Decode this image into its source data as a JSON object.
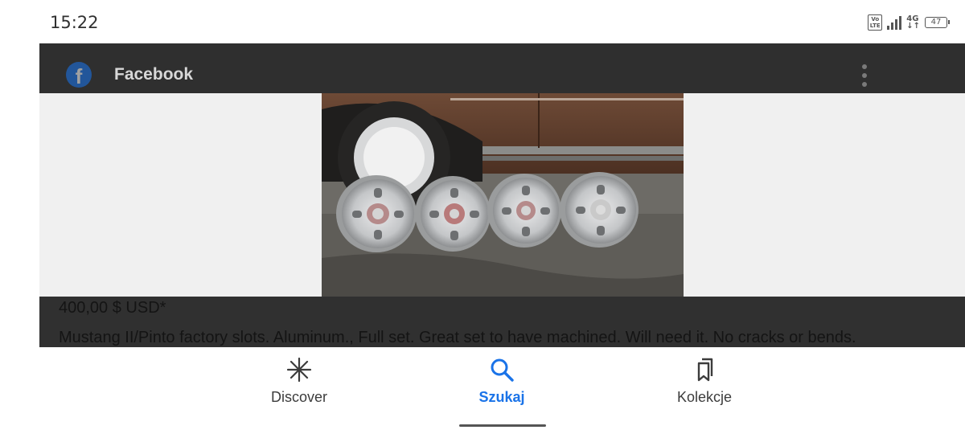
{
  "status_bar": {
    "time": "15:22",
    "volte": "Vo LTE",
    "network": "4G",
    "battery": "47"
  },
  "source": {
    "name": "Facebook",
    "icon": "facebook-icon"
  },
  "listing": {
    "price": "400,00 $ USD*",
    "description": "Mustang II/Pinto factory slots. Aluminum., Full set. Great set to have machined. Will need it. No cracks or bends."
  },
  "bottom_nav": {
    "items": [
      {
        "label": "Discover",
        "icon": "discover-icon",
        "active": false
      },
      {
        "label": "Szukaj",
        "icon": "search-icon",
        "active": true
      },
      {
        "label": "Kolekcje",
        "icon": "bookmarks-icon",
        "active": false
      }
    ]
  },
  "colors": {
    "accent": "#1a73e8",
    "overlay": "#2f2f2f",
    "facebook": "#1877f2"
  }
}
